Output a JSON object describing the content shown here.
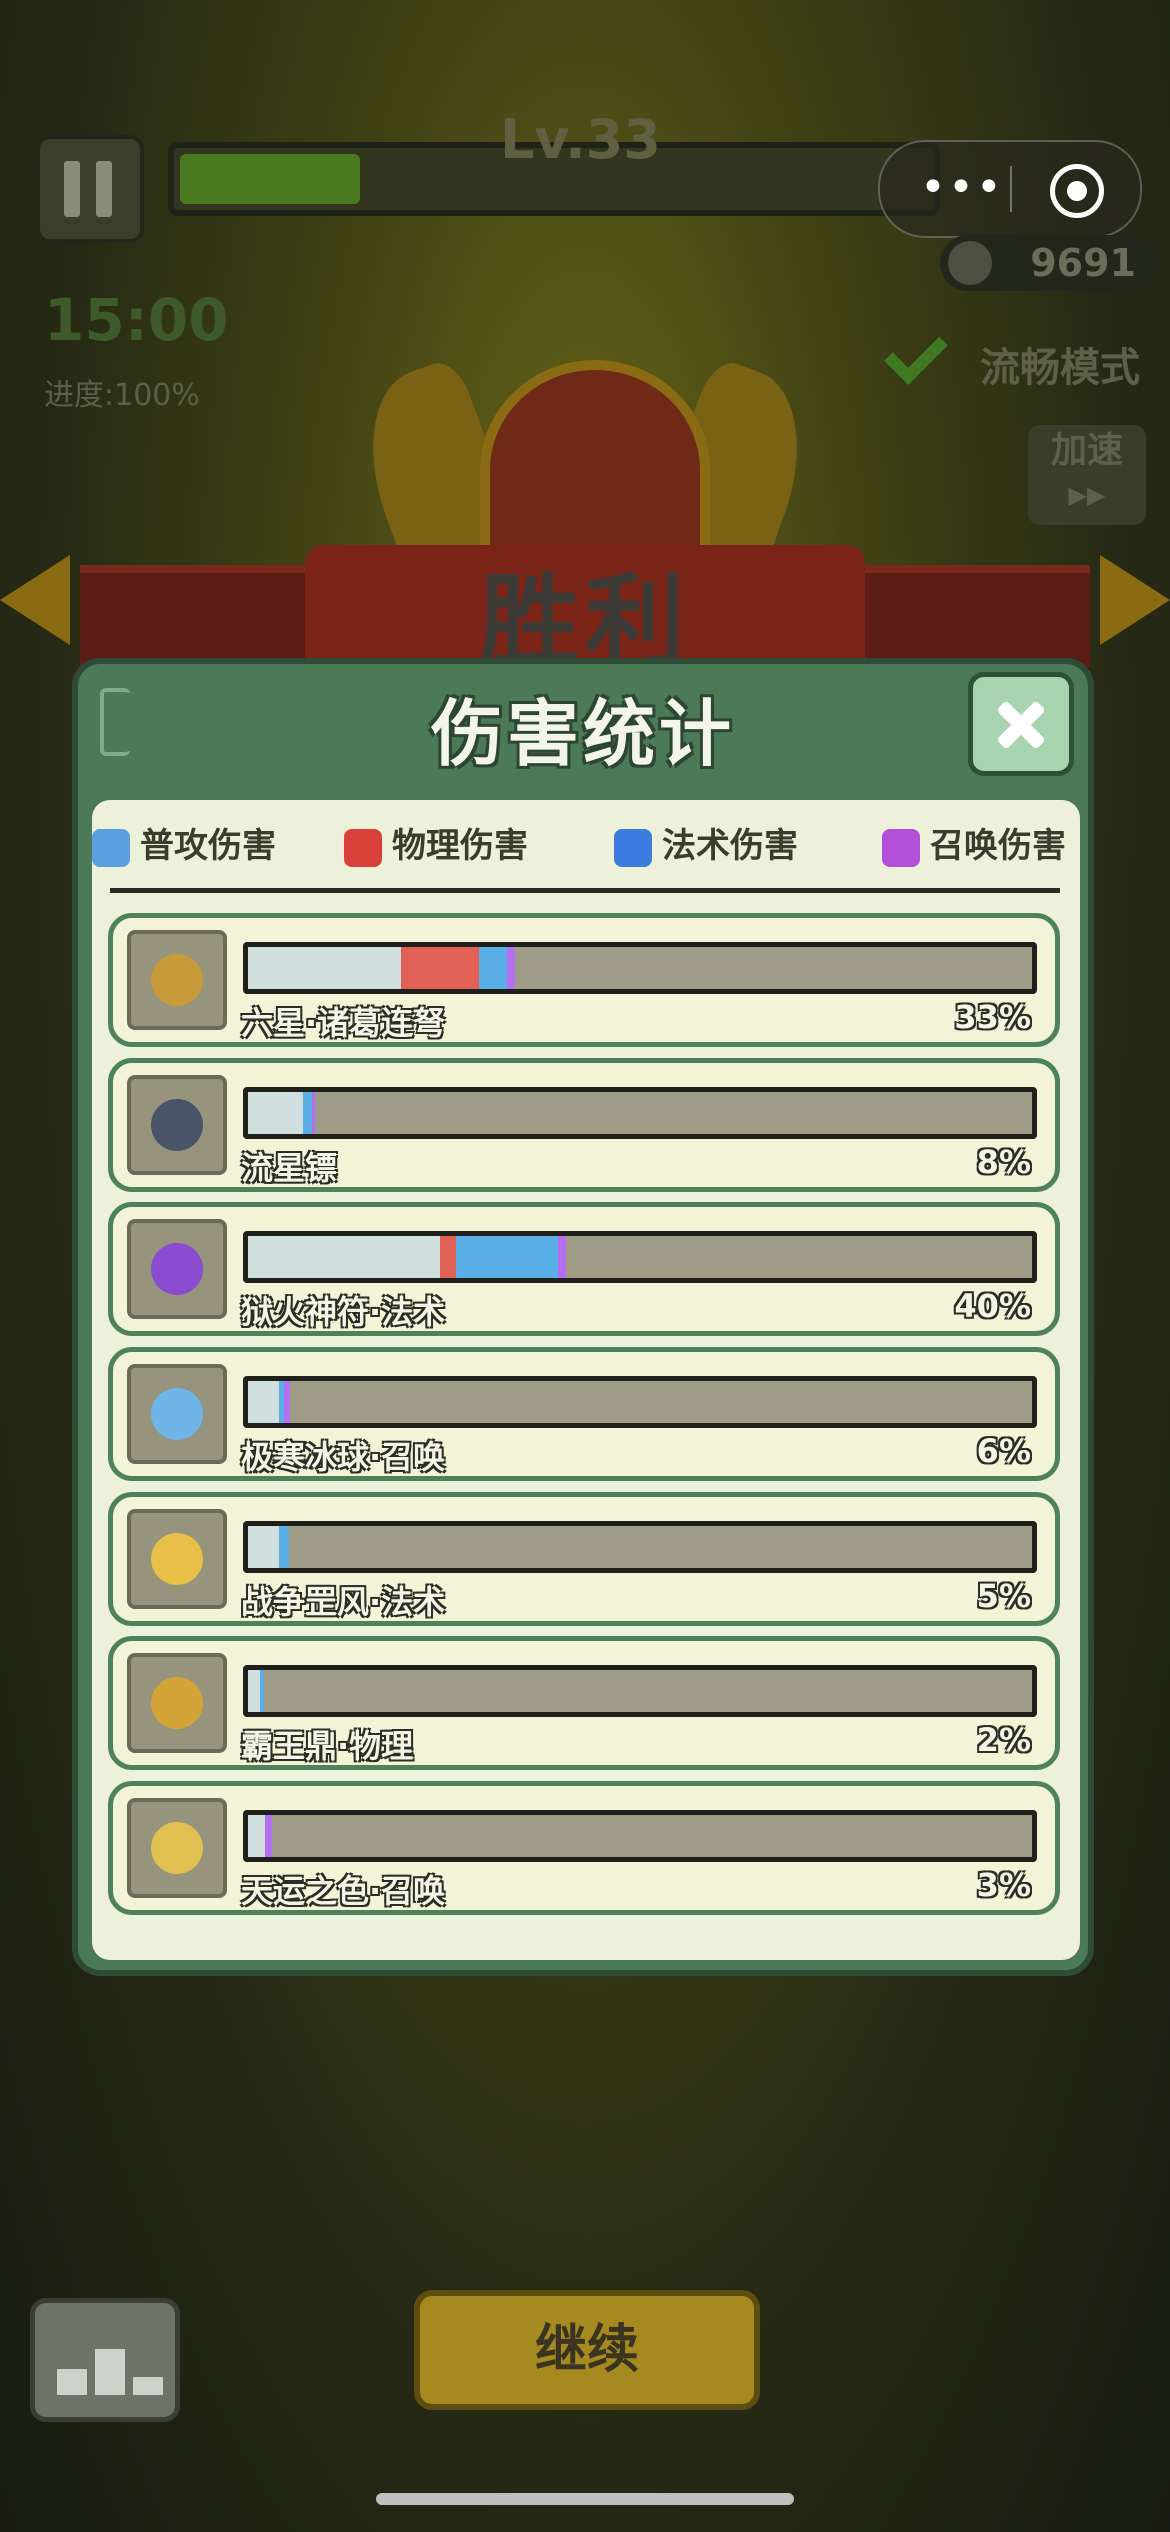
{
  "hud": {
    "level": "Lv.33",
    "xp_progress": 0.24,
    "kills": "9691",
    "timer": "15:00",
    "progress_text": "进度:100%",
    "smooth_mode": "流畅模式",
    "speed_label": "加速",
    "speed_arrows": "▶▶"
  },
  "miniprogram": {
    "more_icon": "•••",
    "close_icon": "target-icon"
  },
  "banner": {
    "title": "胜利"
  },
  "panel": {
    "title": "伤害统计",
    "close_icon": "close-icon",
    "tabs": [
      {
        "label": "普攻伤害",
        "icon": "sword-icon",
        "color": "#5aa0e0"
      },
      {
        "label": "物理伤害",
        "icon": "fist-icon",
        "color": "#d9403a"
      },
      {
        "label": "法术伤害",
        "icon": "flame-icon",
        "color": "#3b7be0"
      },
      {
        "label": "召唤伤害",
        "icon": "paw-icon",
        "color": "#b14fd8"
      }
    ],
    "colors": {
      "normal": "#d0dedd",
      "physical": "#e06155",
      "magic": "#5aafe6",
      "summon": "#b66ff0"
    },
    "rows": [
      {
        "name": "六星·诸葛连弩",
        "percent": "33%",
        "icon": "crossbow-icon",
        "segments": {
          "normal": 0.195,
          "physical": 0.1,
          "magic": 0.035,
          "summon": 0.01
        }
      },
      {
        "name": "流星镖",
        "percent": "8%",
        "icon": "shuriken-icon",
        "segments": {
          "normal": 0.07,
          "physical": 0.0,
          "magic": 0.012,
          "summon": 0.004
        }
      },
      {
        "name": "狱火神符·法术",
        "percent": "40%",
        "icon": "talisman-icon",
        "segments": {
          "normal": 0.245,
          "physical": 0.02,
          "magic": 0.13,
          "summon": 0.01
        }
      },
      {
        "name": "极寒冰球·召唤",
        "percent": "6%",
        "icon": "ice-orb-icon",
        "segments": {
          "normal": 0.04,
          "physical": 0.0,
          "magic": 0.006,
          "summon": 0.008
        }
      },
      {
        "name": "战争罡风·法术",
        "percent": "5%",
        "icon": "wind-ring-icon",
        "segments": {
          "normal": 0.04,
          "physical": 0.0,
          "magic": 0.012,
          "summon": 0.0
        }
      },
      {
        "name": "霸王鼎·物理",
        "percent": "2%",
        "icon": "cauldron-icon",
        "segments": {
          "normal": 0.015,
          "physical": 0.0,
          "magic": 0.005,
          "summon": 0.0
        }
      },
      {
        "name": "天运之色·召唤",
        "percent": "3%",
        "icon": "dice-icon",
        "segments": {
          "normal": 0.022,
          "physical": 0.0,
          "magic": 0.0,
          "summon": 0.008
        }
      }
    ]
  },
  "bottom": {
    "continue_label": "继续",
    "rank_icon": "podium-icon"
  }
}
